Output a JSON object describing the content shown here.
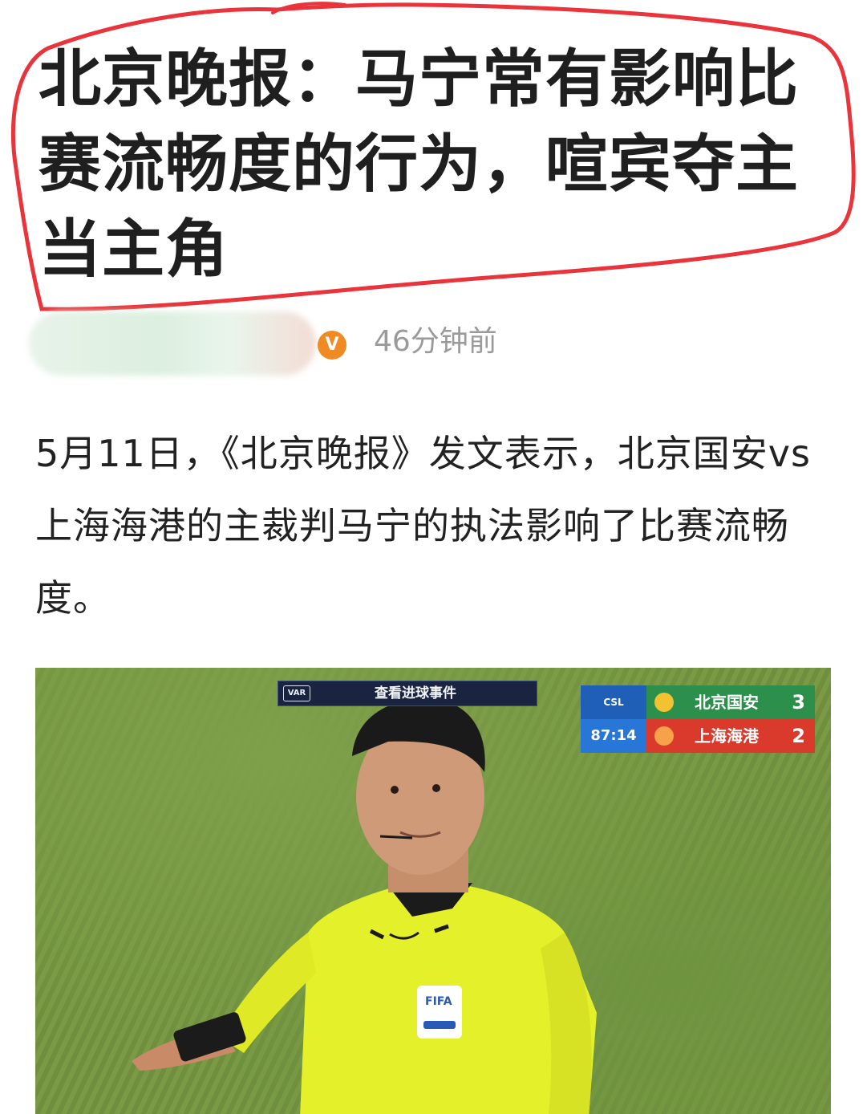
{
  "article": {
    "headline": "北京晚报：马宁常有影响比赛流畅度的行为，喧宾夺主当主角",
    "verified_badge": "V",
    "time_ago": "46分钟前",
    "body": "5月11日，《北京晚报》发文表示，北京国安vs上海海港的主裁判马宁的执法影响了比赛流畅度。"
  },
  "video": {
    "var_tag": "VAR",
    "var_title": "查看进球事件",
    "league_logo": "CSL",
    "clock": "87:14",
    "home_team": "北京国安",
    "home_score": "3",
    "away_team": "上海海港",
    "away_score": "2",
    "patch_text": "FIFA"
  },
  "colors": {
    "annotation_circle": "#e8343a",
    "verified_badge": "#f08a24",
    "time_text": "#9a9a9a",
    "home_team_bg": "#2c8f4b",
    "away_team_bg": "#d93a2b",
    "referee_shirt": "#e4f02a"
  }
}
